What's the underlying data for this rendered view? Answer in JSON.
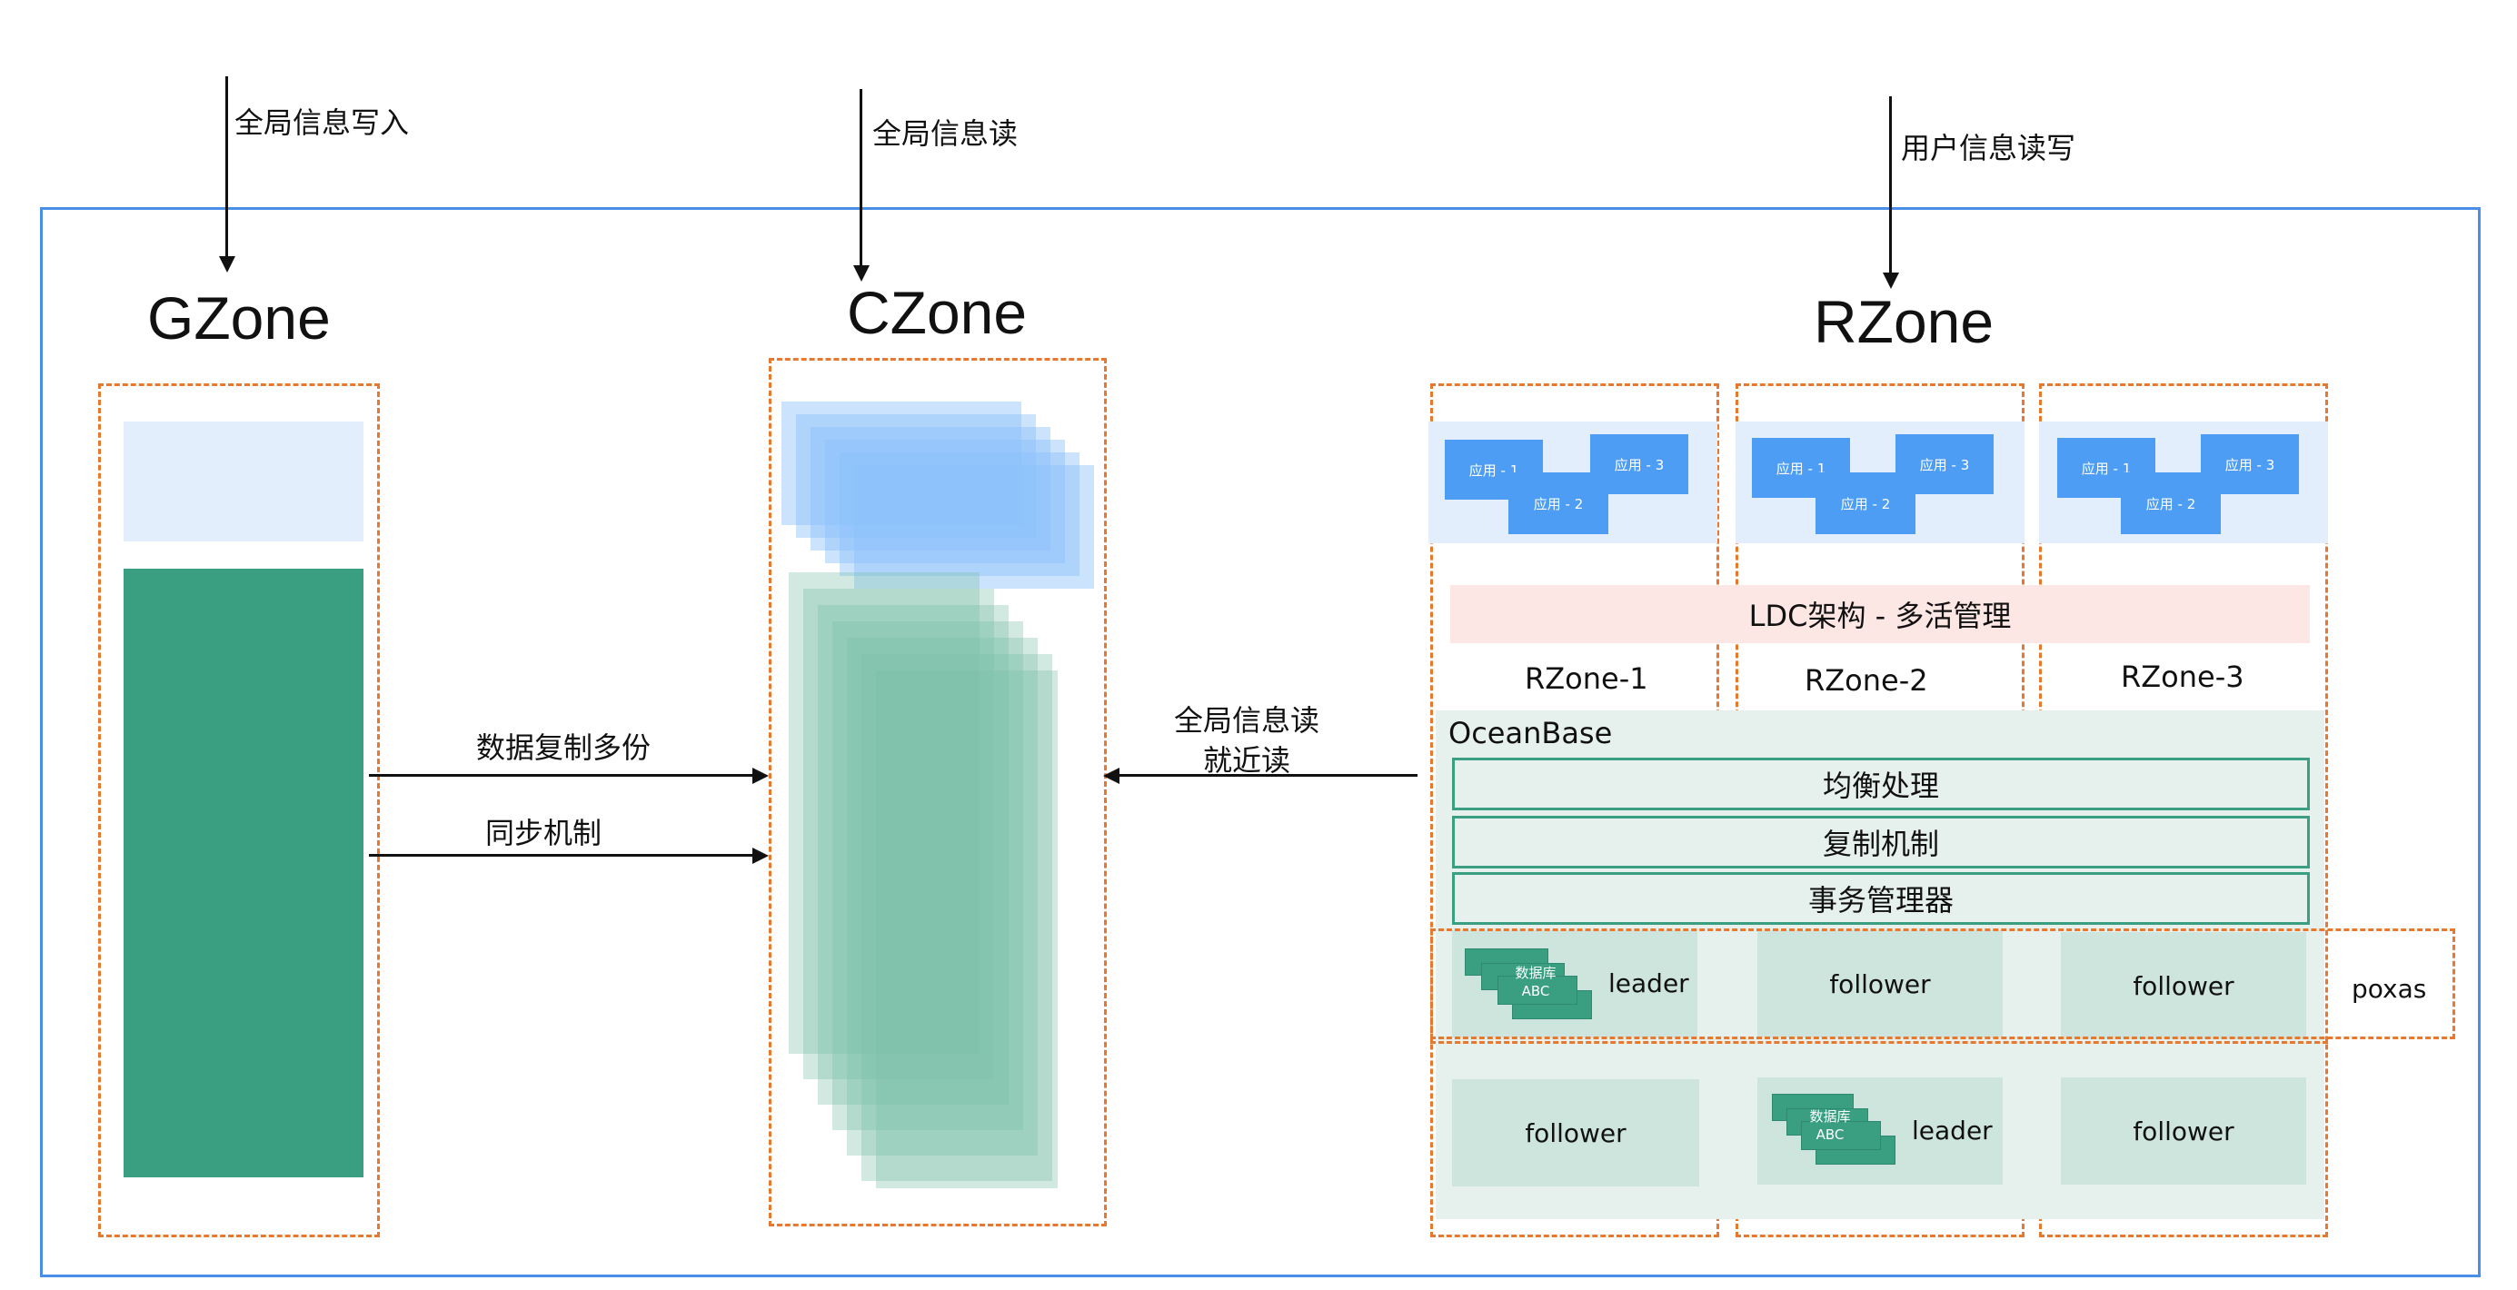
{
  "inputs": {
    "gzone": "全局信息写入",
    "czone": "全局信息读",
    "rzone": "用户信息读写"
  },
  "zones": {
    "gzone": "GZone",
    "czone": "CZone",
    "rzone": "RZone"
  },
  "links": {
    "replicate": "数据复制多份",
    "sync": "同步机制",
    "nearby_line1": "全局信息读",
    "nearby_line2": "就近读"
  },
  "rzone": {
    "apps": [
      "应用 - 1",
      "应用 - 2",
      "应用 - 3"
    ],
    "ldc": "LDC架构 - 多活管理",
    "subzones": [
      "RZone-1",
      "RZone-2",
      "RZone-3"
    ],
    "oceanbase": {
      "title": "OceanBase",
      "layers": [
        "均衡处理",
        "复制机制",
        "事务管理器"
      ]
    },
    "db_line1": "数据库",
    "db_line2": "ABC",
    "row1": [
      "leader",
      "follower",
      "follower"
    ],
    "row2": [
      "follower",
      "leader",
      "follower"
    ],
    "group_label": "poxas"
  },
  "colors": {
    "outer_border": "#4a8fe7",
    "dashed_border": "#e8782d",
    "green": "#3a9e80",
    "app_blue": "#4d9df4",
    "light_blue": "#e2eefb",
    "pink": "#fde7e5"
  }
}
